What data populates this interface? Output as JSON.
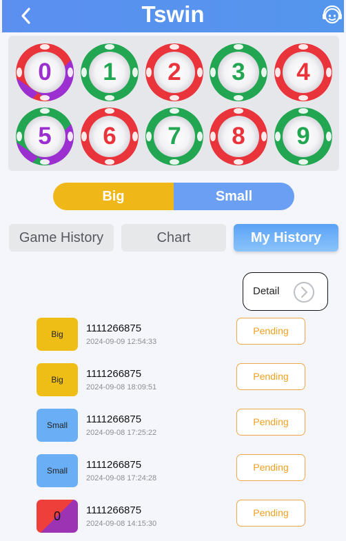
{
  "header": {
    "title": "Tswin",
    "back_icon": "chevron-left-icon",
    "support_icon": "headset-icon",
    "color": "#5b8ff0"
  },
  "balls": [
    {
      "number": "0",
      "colors": [
        "#e8343a",
        "#9b2fd0"
      ]
    },
    {
      "number": "1",
      "colors": [
        "#22a652"
      ]
    },
    {
      "number": "2",
      "colors": [
        "#e8343a"
      ]
    },
    {
      "number": "3",
      "colors": [
        "#22a652"
      ]
    },
    {
      "number": "4",
      "colors": [
        "#e8343a"
      ]
    },
    {
      "number": "5",
      "colors": [
        "#22a652",
        "#9b2fd0"
      ]
    },
    {
      "number": "6",
      "colors": [
        "#e8343a"
      ]
    },
    {
      "number": "7",
      "colors": [
        "#22a652"
      ]
    },
    {
      "number": "8",
      "colors": [
        "#e8343a"
      ]
    },
    {
      "number": "9",
      "colors": [
        "#22a652"
      ]
    }
  ],
  "bet_options": {
    "big": "Big",
    "small": "Small"
  },
  "tabs": {
    "game_history": "Game History",
    "chart": "Chart",
    "my_history": "My History",
    "active": "my_history"
  },
  "detail": {
    "label": "Detail",
    "icon": "chevron-right-circle-icon"
  },
  "history": [
    {
      "bet": "Big",
      "type": "big",
      "issue": "1111266875",
      "time": "2024-09-09 12:54:33",
      "status": "Pending"
    },
    {
      "bet": "Big",
      "type": "big",
      "issue": "1111266875",
      "time": "2024-09-08 18:09:51",
      "status": "Pending"
    },
    {
      "bet": "Small",
      "type": "small",
      "issue": "1111266875",
      "time": "2024-09-08 17:25:22",
      "status": "Pending"
    },
    {
      "bet": "Small",
      "type": "small",
      "issue": "1111266875",
      "time": "2024-09-08 17:24:28",
      "status": "Pending"
    },
    {
      "bet": "0",
      "type": "number",
      "issue": "1111266875",
      "time": "2024-09-08 14:15:30",
      "status": "Pending"
    }
  ]
}
